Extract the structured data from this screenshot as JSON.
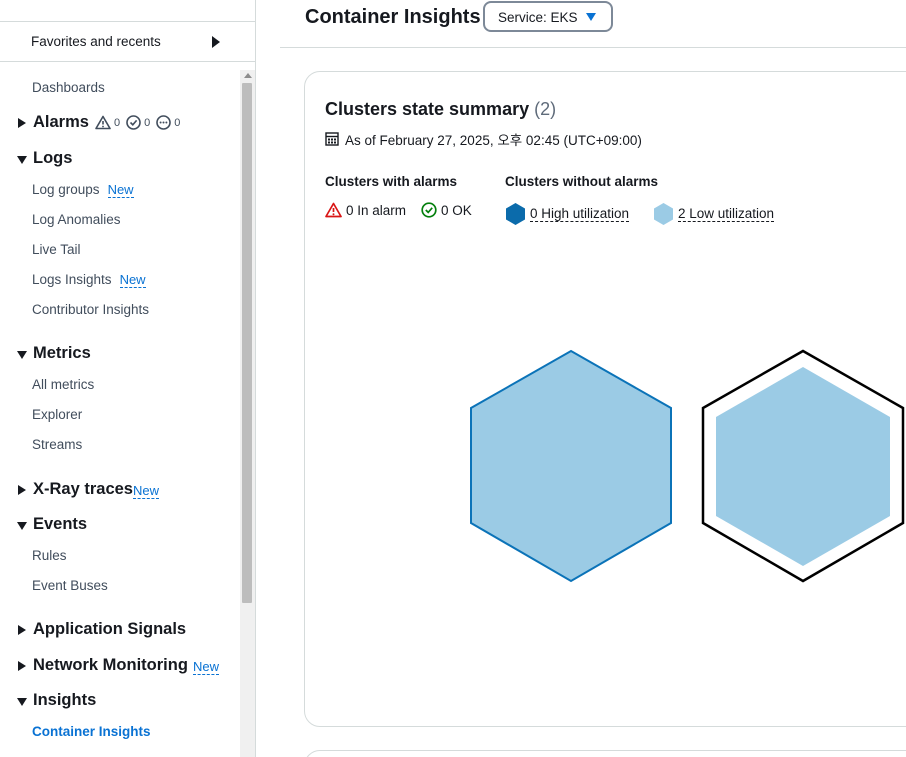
{
  "sidebar": {
    "favorites_label": "Favorites and recents",
    "dashboards": "Dashboards",
    "alarms": {
      "title": "Alarms",
      "in_alarm": "0",
      "ok": "0",
      "insufficient": "0"
    },
    "logs": {
      "title": "Logs",
      "items": [
        {
          "label": "Log groups",
          "badge": "New"
        },
        {
          "label": "Log Anomalies"
        },
        {
          "label": "Live Tail"
        },
        {
          "label": "Logs Insights",
          "badge": "New"
        },
        {
          "label": "Contributor Insights"
        }
      ]
    },
    "metrics": {
      "title": "Metrics",
      "items": [
        {
          "label": "All metrics"
        },
        {
          "label": "Explorer"
        },
        {
          "label": "Streams"
        }
      ]
    },
    "xray": {
      "title": "X-Ray traces",
      "badge": "New"
    },
    "events": {
      "title": "Events",
      "items": [
        {
          "label": "Rules"
        },
        {
          "label": "Event Buses"
        }
      ]
    },
    "application_signals": {
      "title": "Application Signals"
    },
    "network_monitoring": {
      "title": "Network Monitoring",
      "badge": "New"
    },
    "insights": {
      "title": "Insights",
      "items": [
        {
          "label": "Container Insights",
          "active": true
        }
      ]
    }
  },
  "header": {
    "title": "Container Insights",
    "service_select": "Service: EKS"
  },
  "summary": {
    "title": "Clusters state summary",
    "count": "(2)",
    "as_of": "As of February 27, 2025, 오후 02:45 (UTC+09:00)",
    "with_alarms_label": "Clusters with alarms",
    "in_alarm": "0 In alarm",
    "ok": "0 OK",
    "without_alarms_label": "Clusters without alarms",
    "high_utilization": "0 High utilization",
    "low_utilization": "2 Low utilization"
  },
  "colors": {
    "accent": "#0972d3",
    "hex_fill": "#9bcbe5",
    "hex_stroke": "#0b73b8",
    "alarm_red": "#d91515",
    "ok_green": "#037f0c",
    "high_util": "#0b6bab"
  },
  "icons": {
    "favorites": "caret-right-icon",
    "alarm": "warning-triangle-icon",
    "ok": "check-circle-icon",
    "insufficient": "ellipsis-circle-icon",
    "calendar": "calendar-icon",
    "select": "caret-down-icon"
  }
}
